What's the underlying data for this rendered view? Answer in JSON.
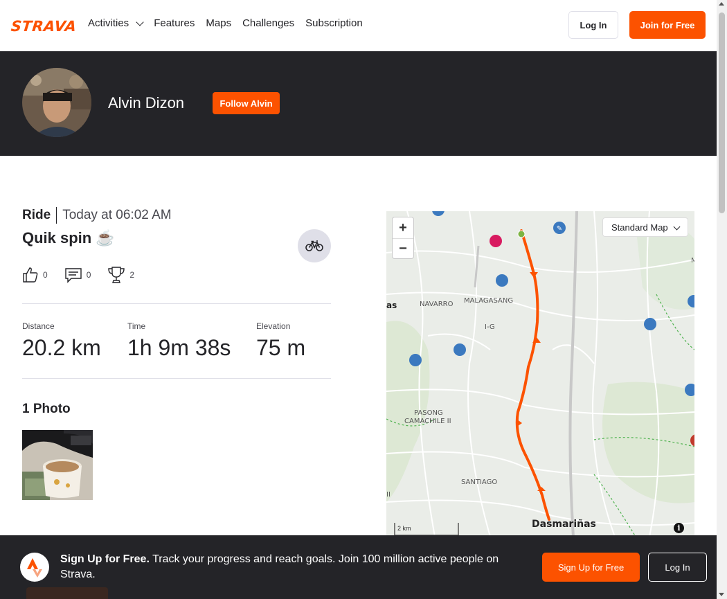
{
  "nav": {
    "logo": "STRAVA",
    "items": [
      "Activities",
      "Features",
      "Maps",
      "Challenges",
      "Subscription"
    ],
    "login_label": "Log In",
    "join_label": "Join for Free"
  },
  "athlete": {
    "name": "Alvin Dizon",
    "follow_label": "Follow Alvin"
  },
  "activity": {
    "type": "Ride",
    "datetime": "Today at 06:02 AM",
    "title": "Quik spin ☕️",
    "kudos": "0",
    "comments": "0",
    "achievements": "2",
    "stats": [
      {
        "label": "Distance",
        "value": "20.2 km"
      },
      {
        "label": "Time",
        "value": "1h 9m 38s"
      },
      {
        "label": "Elevation",
        "value": "75 m"
      }
    ],
    "photos_heading": "1 Photo"
  },
  "map": {
    "style_option": "Standard Map",
    "zoom_in": "+",
    "zoom_out": "−",
    "scale": "2 km",
    "info": "i",
    "labels": [
      "NAVARRO",
      "MALAGASANG",
      "I-G",
      "PASONG",
      "CAMACHILE II",
      "SANTIAGO",
      "Dasmariñas",
      "as",
      "II",
      "M"
    ]
  },
  "signup": {
    "headline": "Sign Up for Free.",
    "body": "Track your progress and reach goals. Join 100 million active people on Strava.",
    "signup_label": "Sign Up for Free",
    "login_label": "Log In"
  },
  "colors": {
    "brand": "#fc5200",
    "dark": "#242428"
  }
}
